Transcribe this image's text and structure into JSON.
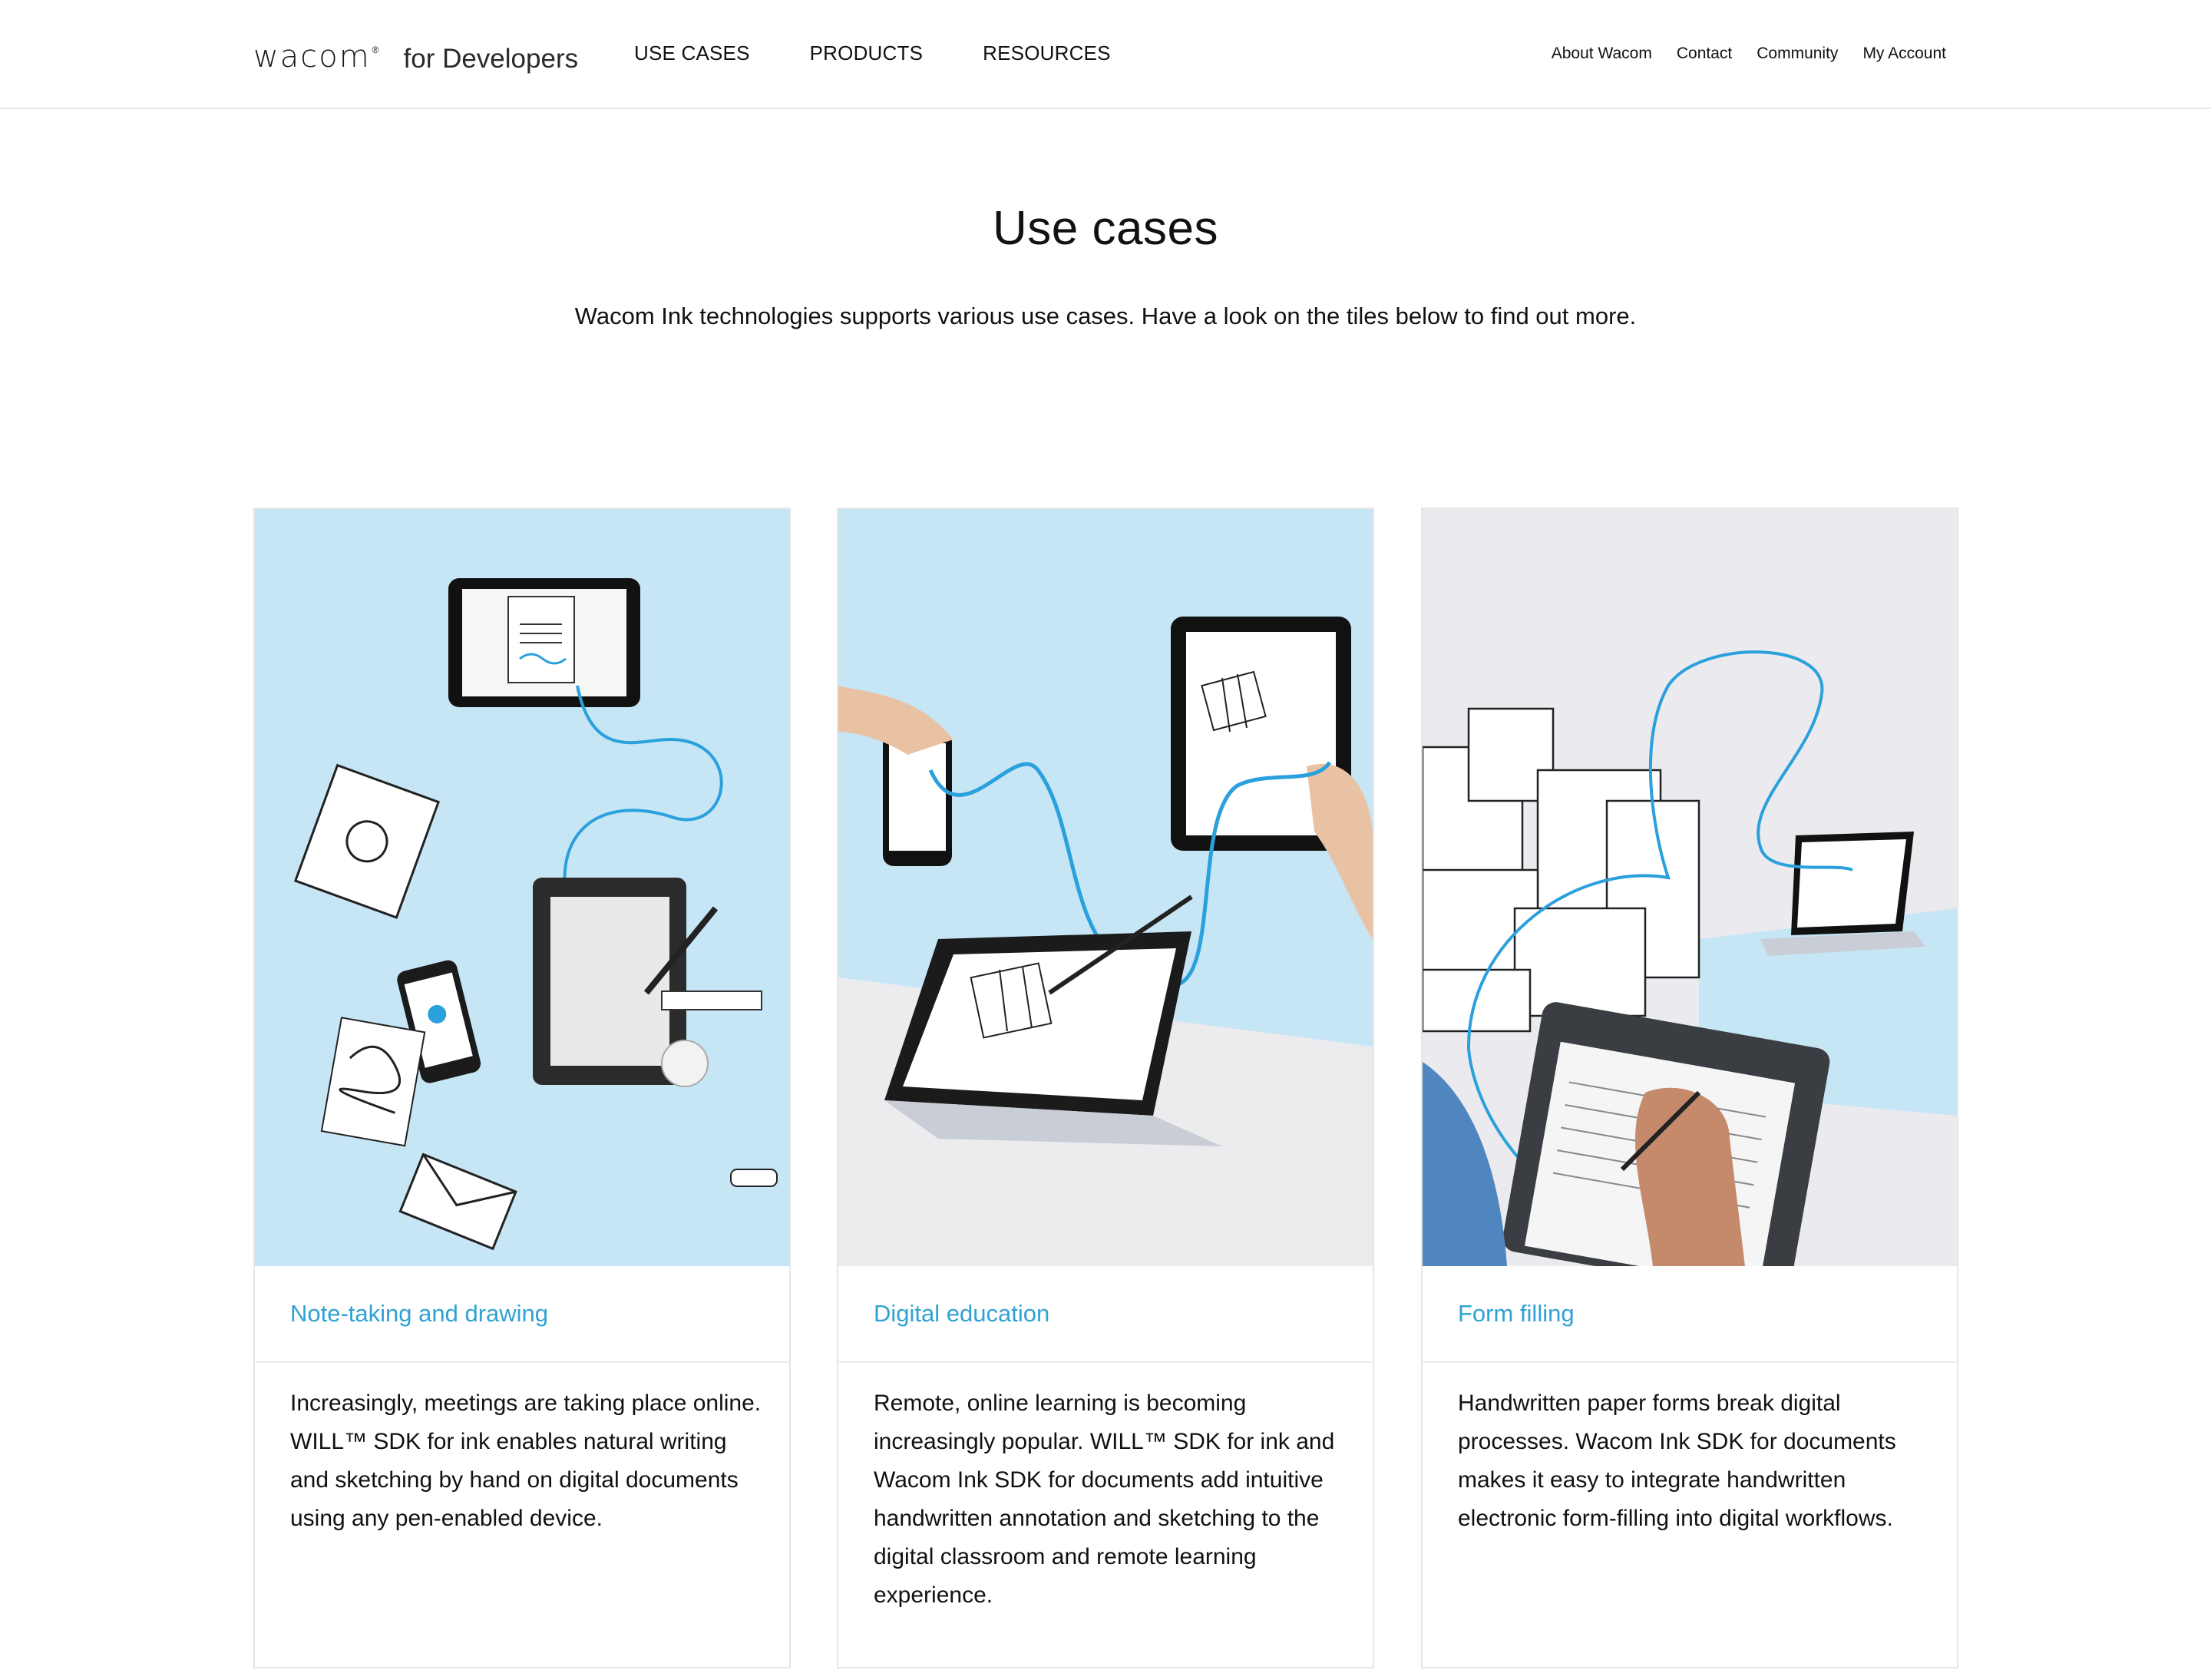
{
  "header": {
    "logo_text": "wacom",
    "logo_sub": "for Developers",
    "main_nav": [
      "USE CASES",
      "PRODUCTS",
      "RESOURCES"
    ],
    "util_nav": [
      "About Wacom",
      "Contact",
      "Community",
      "My Account"
    ]
  },
  "intro": {
    "title": "Use cases",
    "subtitle": "Wacom Ink technologies supports various use cases. Have a look on the tiles below to find out more."
  },
  "cards": [
    {
      "title": "Note-taking and drawing",
      "body": "Increasingly, meetings are taking place online. WILL™ SDK for ink enables natural writing and sketching by hand on digital documents using any pen-enabled device.",
      "bg_color": "#c6e6f6"
    },
    {
      "title": "Digital education",
      "body": "Remote, online learning is becoming increasingly popular. WILL™ SDK for ink and Wacom Ink SDK for documents add intuitive handwritten annotation and sketching to the digital classroom and remote learning experience.",
      "bg_color": "#c6e6f6"
    },
    {
      "title": "Form filling",
      "body": "Handwritten paper forms break digital processes. Wacom Ink SDK for documents makes it easy to integrate handwritten electronic form-filling into digital workflows.",
      "bg_color": "#ebebef"
    }
  ],
  "colors": {
    "accent": "#2fa2d3",
    "ink_line": "#2aa0dc"
  }
}
